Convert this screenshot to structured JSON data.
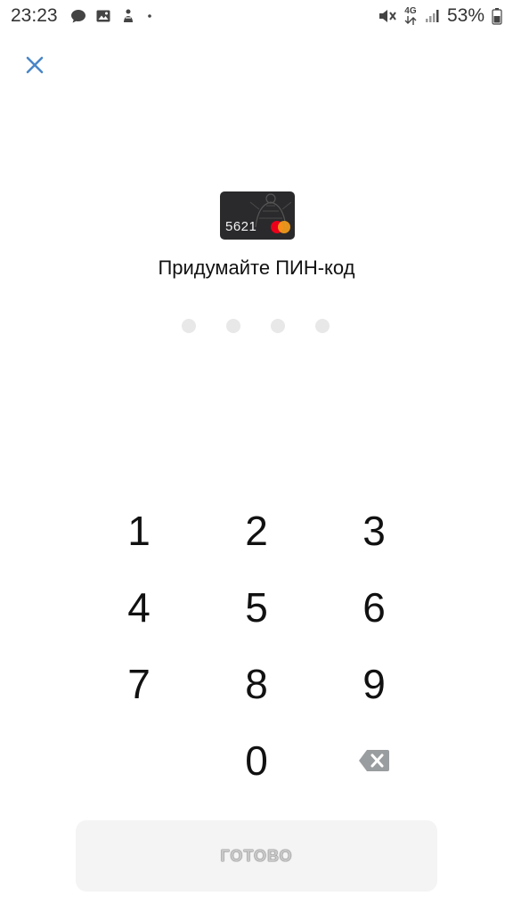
{
  "status_bar": {
    "time": "23:23",
    "battery": "53%",
    "network": "4G",
    "icons": [
      "message-icon",
      "gallery-icon",
      "app-icon",
      "dot-icon",
      "mute-icon",
      "data-arrows-icon",
      "signal-icon",
      "battery-icon"
    ]
  },
  "close": {
    "icon": "close-icon",
    "color": "#4a86c8"
  },
  "card": {
    "number": "5621",
    "background": "#2a2a2c",
    "brand_icon": "mastercard-icon"
  },
  "title": "Придумайте ПИН-код",
  "pin": {
    "length": 4,
    "filled": 0
  },
  "keypad": {
    "keys": [
      "1",
      "2",
      "3",
      "4",
      "5",
      "6",
      "7",
      "8",
      "9",
      "",
      "0",
      "backspace"
    ]
  },
  "done_button": {
    "label": "ГОТОВО"
  }
}
